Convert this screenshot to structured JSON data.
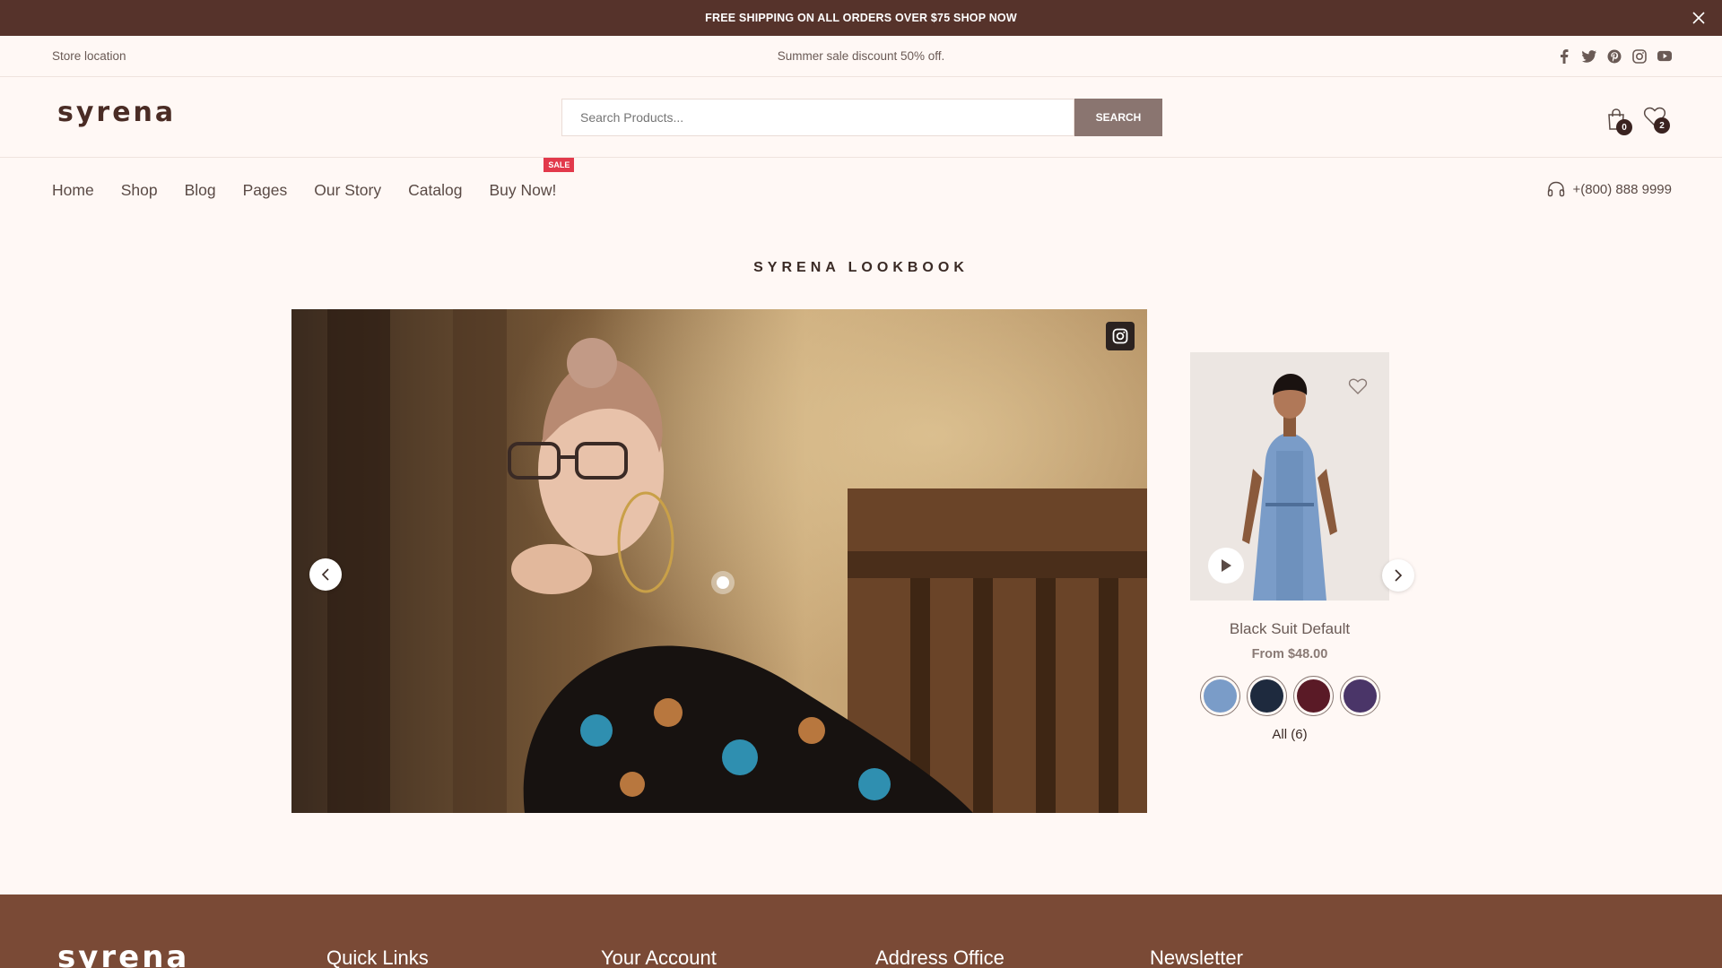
{
  "announcement": {
    "text": "FREE SHIPPING ON ALL ORDERS OVER $75 SHOP NOW",
    "close_icon": "close-icon"
  },
  "topbar": {
    "store_location": "Store location",
    "promo": "Summer sale discount 50% off.",
    "socials": [
      "facebook-icon",
      "twitter-icon",
      "pinterest-icon",
      "instagram-icon",
      "youtube-icon"
    ]
  },
  "header": {
    "logo": "syrena",
    "search_placeholder": "Search Products...",
    "search_button": "SEARCH",
    "cart_count": "0",
    "wishlist_count": "2"
  },
  "nav": {
    "items": [
      "Home",
      "Shop",
      "Blog",
      "Pages",
      "Our Story",
      "Catalog",
      "Buy Now!"
    ],
    "sale_badge": "SALE",
    "phone": "+(800) 888 9999"
  },
  "lookbook": {
    "title": "SYRENA LOOKBOOK"
  },
  "product": {
    "name": "Black Suit Default",
    "price": "From $48.00",
    "swatch_colors": [
      "#7a9cc8",
      "#1e2a3e",
      "#5a1a26",
      "#4a3568"
    ],
    "all_count": "All (6)"
  },
  "footer": {
    "logo": "syrena",
    "headings": [
      "Quick Links",
      "Your Account",
      "Address Office",
      "Newsletter"
    ]
  },
  "colors": {
    "announcement_bg": "#56332b",
    "page_bg": "#fff8f5",
    "search_button_bg": "#8a7570",
    "sale_badge": "#e2394b",
    "footer_bg": "#7a4a36"
  }
}
